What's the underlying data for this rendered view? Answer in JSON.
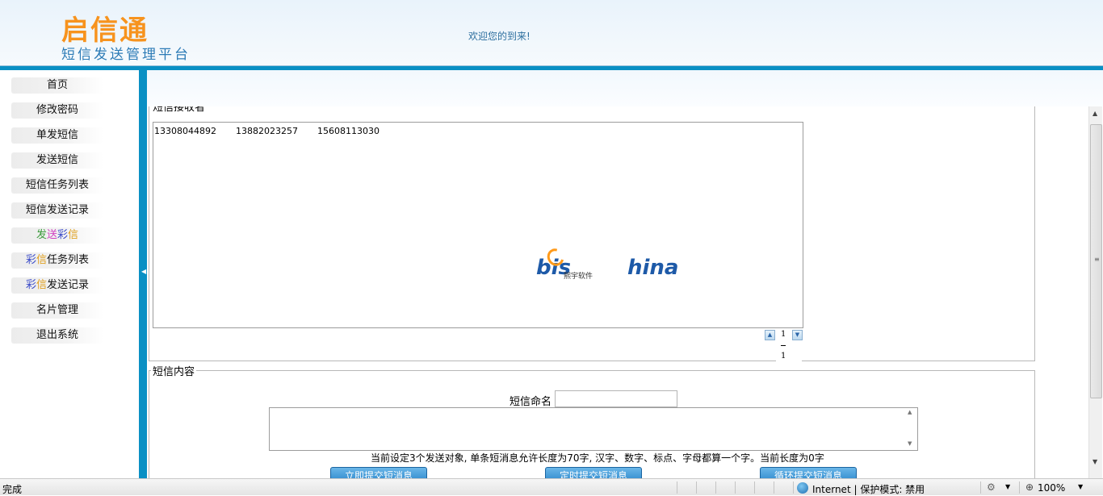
{
  "header": {
    "logo_title": "启信通",
    "logo_subtitle": "短信发送管理平台",
    "welcome": "欢迎您的到来!"
  },
  "sidebar": {
    "items": [
      {
        "label": "首页"
      },
      {
        "label": "修改密码"
      },
      {
        "label": "单发短信"
      },
      {
        "label": "发送短信"
      },
      {
        "label": "短信任务列表"
      },
      {
        "label": "短信发送记录"
      },
      {
        "label": "发送彩信",
        "parts": [
          {
            "text": "发",
            "color": "#3c9a3c"
          },
          {
            "text": "送",
            "color": "#d040c0"
          },
          {
            "text": "彩",
            "color": "#3c4cc8"
          },
          {
            "text": "信",
            "color": "#e0a020"
          }
        ]
      },
      {
        "label": "彩信任务列表",
        "parts": [
          {
            "text": "彩",
            "color": "#3c4cc8"
          },
          {
            "text": "信",
            "color": "#e0a020"
          },
          {
            "text": "任务列表",
            "color": "#111111"
          }
        ]
      },
      {
        "label": "彩信发送记录",
        "parts": [
          {
            "text": "彩",
            "color": "#3c4cc8"
          },
          {
            "text": "信",
            "color": "#e0a020"
          },
          {
            "text": "发送记录",
            "color": "#111111"
          }
        ]
      },
      {
        "label": "名片管理"
      },
      {
        "label": "退出系统"
      }
    ]
  },
  "receivers": {
    "legend": "短信接收者",
    "numbers": [
      "13308044892",
      "13882023257",
      "15608113030"
    ],
    "brand": {
      "part1": "bis",
      "part2": "hina",
      "sub": "熙宇软件"
    },
    "pager": {
      "current": "1",
      "total": "1"
    }
  },
  "content": {
    "legend": "短信内容",
    "name_label": "短信命名",
    "name_value": "",
    "message_value": "",
    "hint": "当前设定3个发送对象, 单条短消息允许长度为70字, 汉字、数字、标点、字母都算一个字。当前长度为0字",
    "buttons": {
      "submit_now": "立即提交短消息",
      "submit_timed": "定时提交短消息",
      "submit_loop": "循环提交短消息"
    }
  },
  "statusbar": {
    "status": "完成",
    "zone": "Internet | 保护模式: 禁用",
    "zoom": "100%"
  },
  "colors": {
    "accent": "#0a90c4",
    "logo_orange": "#f7931e",
    "logo_blue": "#2c7bb6"
  }
}
